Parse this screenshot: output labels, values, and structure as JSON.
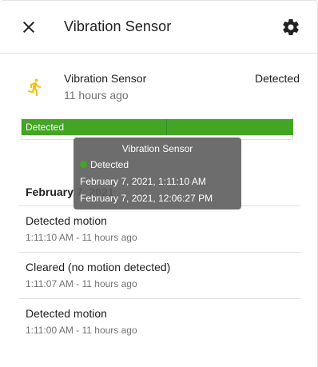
{
  "dialog": {
    "title": "Vibration Sensor",
    "close_icon": "close-icon",
    "settings_icon": "gear-icon"
  },
  "entity": {
    "icon": "motion-run-icon",
    "icon_color": "#f4c20d",
    "name": "Vibration Sensor",
    "last_changed": "11 hours ago",
    "state": "Detected"
  },
  "timeline": {
    "bar_color": "#43a524",
    "label": "Detected"
  },
  "tooltip": {
    "title": "Vibration Sensor",
    "state": "Detected",
    "start": "February 7, 2021, 1:11:10 AM",
    "end": "February 7, 2021, 12:06:27 PM"
  },
  "logbook": {
    "date": "February 7, 2021",
    "entries": [
      {
        "message": "Detected motion",
        "time": "1:11:10 AM - 11 hours ago"
      },
      {
        "message": "Cleared (no motion detected)",
        "time": "1:11:07 AM - 11 hours ago"
      },
      {
        "message": "Detected motion",
        "time": "1:11:00 AM - 11 hours ago"
      }
    ]
  }
}
